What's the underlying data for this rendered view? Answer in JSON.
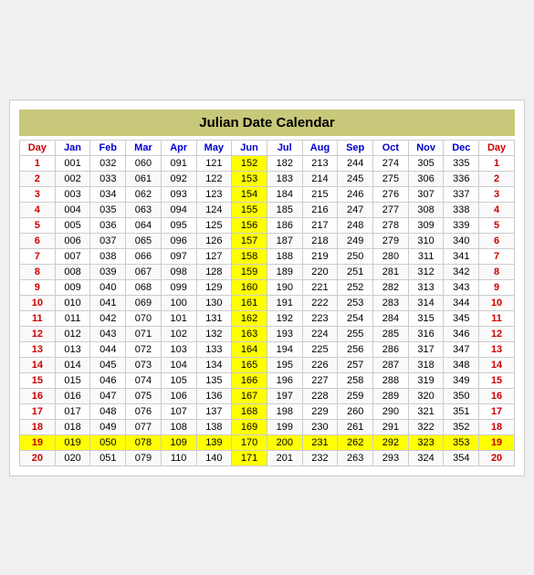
{
  "title": "Julian Date Calendar",
  "headers": [
    "Day",
    "Jan",
    "Feb",
    "Mar",
    "Apr",
    "May",
    "Jun",
    "Jul",
    "Aug",
    "Sep",
    "Oct",
    "Nov",
    "Dec",
    "Day"
  ],
  "rows": [
    {
      "day": 1,
      "jan": "001",
      "feb": "032",
      "mar": "060",
      "apr": "091",
      "may": "121",
      "jun": "152",
      "jul": "182",
      "aug": "213",
      "sep": "244",
      "oct": "274",
      "nov": "305",
      "dec": "335"
    },
    {
      "day": 2,
      "jan": "002",
      "feb": "033",
      "mar": "061",
      "apr": "092",
      "may": "122",
      "jun": "153",
      "jul": "183",
      "aug": "214",
      "sep": "245",
      "oct": "275",
      "nov": "306",
      "dec": "336"
    },
    {
      "day": 3,
      "jan": "003",
      "feb": "034",
      "mar": "062",
      "apr": "093",
      "may": "123",
      "jun": "154",
      "jul": "184",
      "aug": "215",
      "sep": "246",
      "oct": "276",
      "nov": "307",
      "dec": "337"
    },
    {
      "day": 4,
      "jan": "004",
      "feb": "035",
      "mar": "063",
      "apr": "094",
      "may": "124",
      "jun": "155",
      "jul": "185",
      "aug": "216",
      "sep": "247",
      "oct": "277",
      "nov": "308",
      "dec": "338"
    },
    {
      "day": 5,
      "jan": "005",
      "feb": "036",
      "mar": "064",
      "apr": "095",
      "may": "125",
      "jun": "156",
      "jul": "186",
      "aug": "217",
      "sep": "248",
      "oct": "278",
      "nov": "309",
      "dec": "339"
    },
    {
      "day": 6,
      "jan": "006",
      "feb": "037",
      "mar": "065",
      "apr": "096",
      "may": "126",
      "jun": "157",
      "jul": "187",
      "aug": "218",
      "sep": "249",
      "oct": "279",
      "nov": "310",
      "dec": "340"
    },
    {
      "day": 7,
      "jan": "007",
      "feb": "038",
      "mar": "066",
      "apr": "097",
      "may": "127",
      "jun": "158",
      "jul": "188",
      "aug": "219",
      "sep": "250",
      "oct": "280",
      "nov": "311",
      "dec": "341"
    },
    {
      "day": 8,
      "jan": "008",
      "feb": "039",
      "mar": "067",
      "apr": "098",
      "may": "128",
      "jun": "159",
      "jul": "189",
      "aug": "220",
      "sep": "251",
      "oct": "281",
      "nov": "312",
      "dec": "342"
    },
    {
      "day": 9,
      "jan": "009",
      "feb": "040",
      "mar": "068",
      "apr": "099",
      "may": "129",
      "jun": "160",
      "jul": "190",
      "aug": "221",
      "sep": "252",
      "oct": "282",
      "nov": "313",
      "dec": "343"
    },
    {
      "day": 10,
      "jan": "010",
      "feb": "041",
      "mar": "069",
      "apr": "100",
      "may": "130",
      "jun": "161",
      "jul": "191",
      "aug": "222",
      "sep": "253",
      "oct": "283",
      "nov": "314",
      "dec": "344"
    },
    {
      "day": 11,
      "jan": "011",
      "feb": "042",
      "mar": "070",
      "apr": "101",
      "may": "131",
      "jun": "162",
      "jul": "192",
      "aug": "223",
      "sep": "254",
      "oct": "284",
      "nov": "315",
      "dec": "345"
    },
    {
      "day": 12,
      "jan": "012",
      "feb": "043",
      "mar": "071",
      "apr": "102",
      "may": "132",
      "jun": "163",
      "jul": "193",
      "aug": "224",
      "sep": "255",
      "oct": "285",
      "nov": "316",
      "dec": "346"
    },
    {
      "day": 13,
      "jan": "013",
      "feb": "044",
      "mar": "072",
      "apr": "103",
      "may": "133",
      "jun": "164",
      "jul": "194",
      "aug": "225",
      "sep": "256",
      "oct": "286",
      "nov": "317",
      "dec": "347"
    },
    {
      "day": 14,
      "jan": "014",
      "feb": "045",
      "mar": "073",
      "apr": "104",
      "may": "134",
      "jun": "165",
      "jul": "195",
      "aug": "226",
      "sep": "257",
      "oct": "287",
      "nov": "318",
      "dec": "348"
    },
    {
      "day": 15,
      "jan": "015",
      "feb": "046",
      "mar": "074",
      "apr": "105",
      "may": "135",
      "jun": "166",
      "jul": "196",
      "aug": "227",
      "sep": "258",
      "oct": "288",
      "nov": "319",
      "dec": "349"
    },
    {
      "day": 16,
      "jan": "016",
      "feb": "047",
      "mar": "075",
      "apr": "106",
      "may": "136",
      "jun": "167",
      "jul": "197",
      "aug": "228",
      "sep": "259",
      "oct": "289",
      "nov": "320",
      "dec": "350"
    },
    {
      "day": 17,
      "jan": "017",
      "feb": "048",
      "mar": "076",
      "apr": "107",
      "may": "137",
      "jun": "168",
      "jul": "198",
      "aug": "229",
      "sep": "260",
      "oct": "290",
      "nov": "321",
      "dec": "351"
    },
    {
      "day": 18,
      "jan": "018",
      "feb": "049",
      "mar": "077",
      "apr": "108",
      "may": "138",
      "jun": "169",
      "jul": "199",
      "aug": "230",
      "sep": "261",
      "oct": "291",
      "nov": "322",
      "dec": "352"
    },
    {
      "day": 19,
      "jan": "019",
      "feb": "050",
      "mar": "078",
      "apr": "109",
      "may": "139",
      "jun": "170",
      "jul": "200",
      "aug": "231",
      "sep": "262",
      "oct": "292",
      "nov": "323",
      "dec": "353"
    },
    {
      "day": 20,
      "jan": "020",
      "feb": "051",
      "mar": "079",
      "apr": "110",
      "may": "140",
      "jun": "171",
      "jul": "201",
      "aug": "232",
      "sep": "263",
      "oct": "293",
      "nov": "324",
      "dec": "354"
    }
  ]
}
